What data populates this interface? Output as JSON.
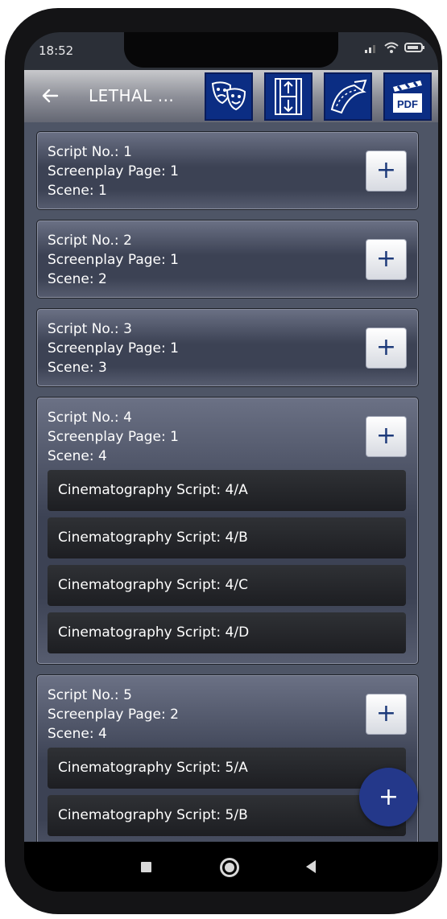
{
  "status": {
    "time": "18:52"
  },
  "appbar": {
    "back_icon": "arrow-left-icon",
    "title": "LETHAL ...",
    "toolbar_icons": [
      "theater-masks-icon",
      "film-strip-icon",
      "film-curve-icon",
      "pdf-clapperboard-icon"
    ]
  },
  "cards": [
    {
      "script_no": "Script No.: 1",
      "page": "Screenplay Page: 1",
      "scene": "Scene: 1",
      "add_label": "+",
      "subs": []
    },
    {
      "script_no": "Script No.: 2",
      "page": "Screenplay Page: 1",
      "scene": "Scene: 2",
      "add_label": "+",
      "subs": []
    },
    {
      "script_no": "Script No.: 3",
      "page": "Screenplay Page: 1",
      "scene": "Scene: 3",
      "add_label": "+",
      "subs": []
    },
    {
      "script_no": "Script No.: 4",
      "page": "Screenplay Page: 1",
      "scene": "Scene: 4",
      "add_label": "+",
      "subs": [
        "Cinematography Script: 4/A",
        "Cinematography Script: 4/B",
        "Cinematography Script: 4/C",
        "Cinematography Script: 4/D"
      ]
    },
    {
      "script_no": "Script No.: 5",
      "page": "Screenplay Page: 2",
      "scene": "Scene: 4",
      "add_label": "+",
      "subs": [
        "Cinematography Script: 5/A",
        "Cinematography Script: 5/B"
      ]
    }
  ],
  "fab": {
    "label": "+"
  },
  "colors": {
    "accent": "#24388a",
    "toolbar_button": "#0b2d83",
    "background": "#4e5566"
  }
}
